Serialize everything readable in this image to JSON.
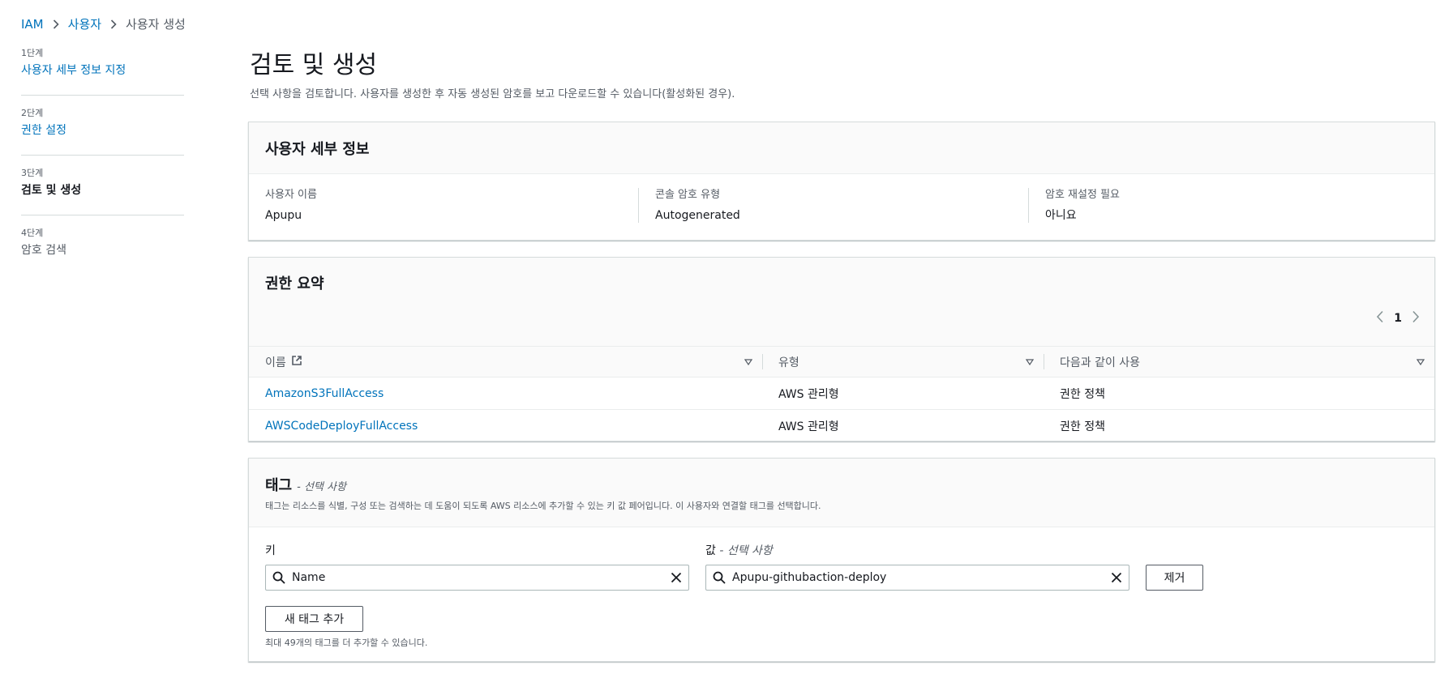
{
  "breadcrumb": {
    "items": [
      "IAM",
      "사용자",
      "사용자 생성"
    ]
  },
  "steps": [
    {
      "number": "1단계",
      "label": "사용자 세부 정보 지정"
    },
    {
      "number": "2단계",
      "label": "권한 설정"
    },
    {
      "number": "3단계",
      "label": "검토 및 생성"
    },
    {
      "number": "4단계",
      "label": "암호 검색"
    }
  ],
  "page": {
    "title": "검토 및 생성",
    "description": "선택 사항을 검토합니다. 사용자를 생성한 후 자동 생성된 암호를 보고 다운로드할 수 있습니다(활성화된 경우)."
  },
  "user_details": {
    "title": "사용자 세부 정보",
    "fields": [
      {
        "label": "사용자 이름",
        "value": "Apupu"
      },
      {
        "label": "콘솔 암호 유형",
        "value": "Autogenerated"
      },
      {
        "label": "암호 재설정 필요",
        "value": "아니요"
      }
    ]
  },
  "permissions": {
    "title": "권한 요약",
    "page": "1",
    "columns": [
      "이름",
      "유형",
      "다음과 같이 사용"
    ],
    "rows": [
      {
        "name": "AmazonS3FullAccess",
        "type": "AWS 관리형",
        "used_as": "권한 정책"
      },
      {
        "name": "AWSCodeDeployFullAccess",
        "type": "AWS 관리형",
        "used_as": "권한 정책"
      }
    ]
  },
  "tags": {
    "title": "태그",
    "optional": "- 선택 사항",
    "description": "태그는 리소스를 식별, 구성 또는 검색하는 데 도움이 되도록 AWS 리소스에 추가할 수 있는 키 값 페어입니다. 이 사용자와 연결할 태그를 선택합니다.",
    "key_label": "키",
    "value_label": "값",
    "value_optional": "- 선택 사항",
    "key_value": "Name",
    "value_value": "Apupu-githubaction-deploy",
    "remove_label": "제거",
    "add_label": "새 태그 추가",
    "hint": "최대 49개의 태그를 더 추가할 수 있습니다."
  },
  "colors": {
    "link": "#0073bb",
    "text": "#16191f",
    "muted": "#545b64",
    "border": "#d5dbdb"
  }
}
